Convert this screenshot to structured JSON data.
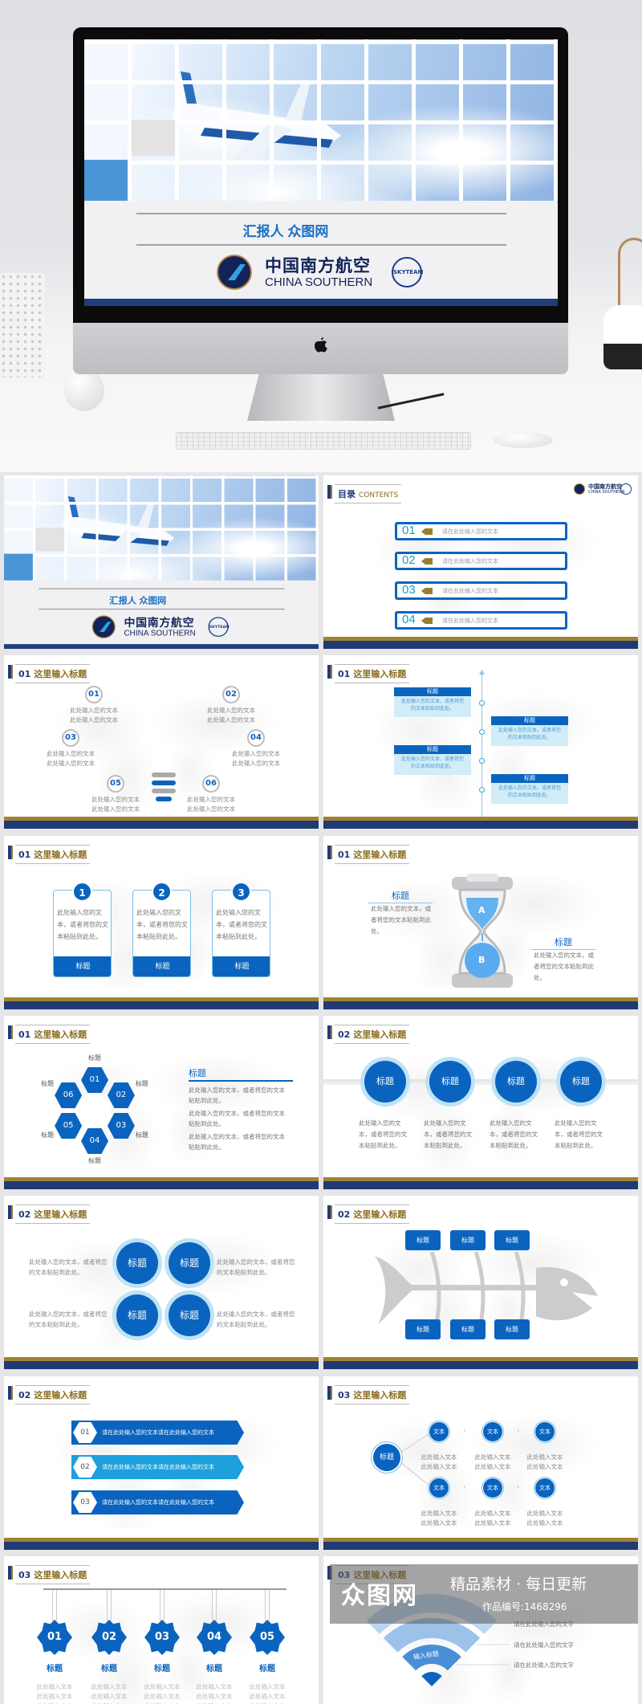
{
  "colors": {
    "navy": "#1f3a74",
    "gold": "#a08332",
    "blue": "#0a64bf",
    "light_blue": "#bfe3f5",
    "teal": "#1a9bc0"
  },
  "cover": {
    "reporter": "汇报人  众图网",
    "airline_cn": "中国南方航空",
    "airline_en": "CHINA SOUTHERN",
    "alliance": "SKYTEAM",
    "logo_icon": "china-southern-kapok-logo"
  },
  "hero": {
    "device": "imac",
    "logo_icon": "apple-logo"
  },
  "toc": {
    "title": "目录",
    "title_en": "CONTENTS",
    "items": [
      {
        "num": "01",
        "text": "请在此处输入您的文本"
      },
      {
        "num": "02",
        "text": "请在此处输入您的文本"
      },
      {
        "num": "03",
        "text": "请在此处输入您的文本"
      },
      {
        "num": "04",
        "text": "请在此处输入您的文本"
      }
    ]
  },
  "slides": [
    {
      "num": "01",
      "title": "这里输入标题",
      "items": [
        {
          "num": "01",
          "l1": "此处输入您的文本",
          "l2": "此处输入您的文本"
        },
        {
          "num": "02",
          "l1": "此处输入您的文本",
          "l2": "此处输入您的文本"
        },
        {
          "num": "03",
          "l1": "此处输入您的文本",
          "l2": "此处输入您的文本"
        },
        {
          "num": "04",
          "l1": "此处输入您的文本",
          "l2": "此处输入您的文本"
        },
        {
          "num": "05",
          "l1": "此处输入您的文本",
          "l2": "此处输入您的文本"
        },
        {
          "num": "06",
          "l1": "此处输入您的文本",
          "l2": "此处输入您的文本"
        }
      ]
    },
    {
      "num": "01",
      "title": "这里输入标题",
      "items": [
        {
          "title": "标题",
          "text": "此处输入您的文本，或者将您的文本粘贴到此处。"
        },
        {
          "title": "标题",
          "text": "此处输入您的文本，或者将您的文本粘贴到此处。"
        },
        {
          "title": "标题",
          "text": "此处输入您的文本，或者将您的文本粘贴到此处。"
        },
        {
          "title": "标题",
          "text": "此处输入您的文本，或者将您的文本粘贴到此处。"
        }
      ]
    },
    {
      "num": "01",
      "title": "这里输入标题",
      "items": [
        {
          "num": "1",
          "text": "此处输入您的文本，或者将您的文本粘贴到此处。",
          "title": "标题"
        },
        {
          "num": "2",
          "text": "此处输入您的文本，或者将您的文本粘贴到此处。",
          "title": "标题"
        },
        {
          "num": "3",
          "text": "此处输入您的文本，或者将您的文本粘贴到此处。",
          "title": "标题"
        }
      ]
    },
    {
      "num": "01",
      "title": "这里输入标题",
      "a": "A",
      "b": "B",
      "items": [
        {
          "title": "标题",
          "text": "此处输入您的文本，或者将您的文本粘贴到此处。"
        },
        {
          "title": "标题",
          "text": "此处输入您的文本，或者将您的文本粘贴到此处。"
        }
      ]
    },
    {
      "num": "01",
      "title": "这里输入标题",
      "petals": [
        "01",
        "02",
        "03",
        "04",
        "05",
        "06"
      ],
      "labels": [
        "标题",
        "标题",
        "标题",
        "标题",
        "标题",
        "标题"
      ],
      "side_title": "标题",
      "side_text": [
        "此处输入您的文本，或者将您的文本粘贴到此处。",
        "此处输入您的文本，或者将您的文本粘贴到此处。",
        "此处输入您的文本，或者将您的文本粘贴到此处。"
      ]
    },
    {
      "num": "02",
      "title": "这里输入标题",
      "items": [
        {
          "title": "标题",
          "text": "此处输入您的文本，或者将您的文本粘贴到此处。"
        },
        {
          "title": "标题",
          "text": "此处输入您的文本，或者将您的文本粘贴到此处。"
        },
        {
          "title": "标题",
          "text": "此处输入您的文本，或者将您的文本粘贴到此处。"
        },
        {
          "title": "标题",
          "text": "此处输入您的文本，或者将您的文本粘贴到此处。"
        }
      ]
    },
    {
      "num": "02",
      "title": "这里输入标题",
      "items": [
        {
          "title": "标题",
          "text": "此处输入您的文本，或者将您的文本粘贴到此处。"
        },
        {
          "title": "标题",
          "text": "此处输入您的文本，或者将您的文本粘贴到此处。"
        },
        {
          "title": "标题",
          "text": "此处输入您的文本，或者将您的文本粘贴到此处。"
        },
        {
          "title": "标题",
          "text": "此处输入您的文本，或者将您的文本粘贴到此处。"
        }
      ]
    },
    {
      "num": "02",
      "title": "这里输入标题",
      "top": [
        "标题",
        "标题",
        "标题"
      ],
      "bottom": [
        "标题",
        "标题",
        "标题"
      ]
    },
    {
      "num": "02",
      "title": "这里输入标题",
      "items": [
        {
          "num": "01",
          "text": "请在此处输入您的文本请在此处输入您的文本"
        },
        {
          "num": "02",
          "text": "请在此处输入您的文本请在此处输入您的文本"
        },
        {
          "num": "03",
          "text": "请在此处输入您的文本请在此处输入您的文本"
        }
      ]
    },
    {
      "num": "03",
      "title": "这里输入标题",
      "center": "标题",
      "node": "文本",
      "line1": "此处输入文本",
      "line2": "此处输入文本"
    },
    {
      "num": "03",
      "title": "这里输入标题",
      "items": [
        {
          "num": "01",
          "title": "标题"
        },
        {
          "num": "02",
          "title": "标题"
        },
        {
          "num": "03",
          "title": "标题"
        },
        {
          "num": "04",
          "title": "标题"
        },
        {
          "num": "05",
          "title": "标题"
        }
      ],
      "line": "此处输入文本"
    },
    {
      "num": "03",
      "title": "这里输入标题",
      "center": "输入标题",
      "bullets": [
        "请在此处输入您的文字",
        "请在此处输入您的文字",
        "请在此处输入您的文字"
      ]
    }
  ],
  "watermark": {
    "brand": "众图网",
    "slogan": "精品素材 · 每日更新",
    "id": "作品编号:1468296"
  }
}
